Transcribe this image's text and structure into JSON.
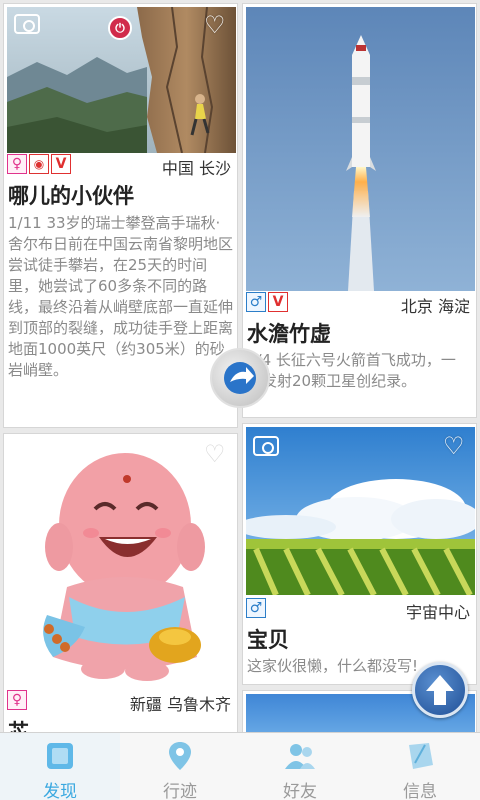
{
  "cards": [
    {
      "badges": [
        "♀",
        "◉",
        "V"
      ],
      "location": "中国 长沙",
      "title": "哪儿的小伙伴",
      "desc": "1/11 33岁的瑞士攀登高手瑞秋·舍尔布日前在中国云南省黎明地区尝试徒手攀岩，在25天的时间里，她尝试了60多条不同的路线，最终沿着从峭壁底部一直延伸到顶部的裂缝，成功徒手登上距离地面1000英尺（约305米）的砂岩峭壁。"
    },
    {
      "badges": [
        "♂",
        "V"
      ],
      "location": "北京 海淀",
      "title": "水澹竹虚",
      "desc": "1/4 长征六号火箭首飞成功，一次发射20颗卫星创纪录。"
    },
    {
      "badges": [
        "♀"
      ],
      "location": "新疆 乌鲁木齐",
      "title": "芯"
    },
    {
      "badges": [
        "♂"
      ],
      "location": "宇宙中心",
      "title": "宝贝",
      "desc": "这家伙很懒，什么都没写!"
    }
  ],
  "nav": {
    "items": [
      {
        "label": "发现",
        "icon": "discover-icon",
        "active": true
      },
      {
        "label": "行迹",
        "icon": "location-pin-icon",
        "active": false
      },
      {
        "label": "好友",
        "icon": "friends-icon",
        "active": false
      },
      {
        "label": "信息",
        "icon": "message-icon",
        "active": false
      }
    ]
  },
  "colors": {
    "accent": "#3aa8e0",
    "female": "#e0338c",
    "male": "#2c7ec8",
    "vip": "#e03030"
  }
}
